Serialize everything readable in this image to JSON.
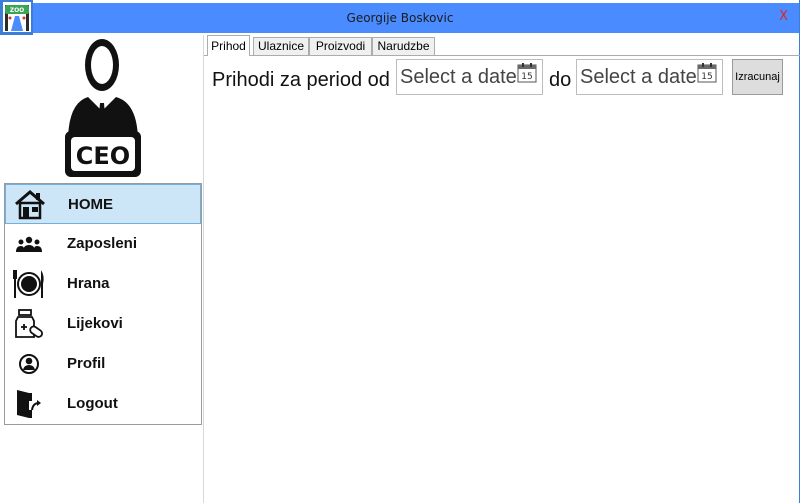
{
  "window": {
    "title": "Georgije Boskovic",
    "close_label": "X",
    "app_icon": "zoo-gate-icon",
    "accent_color": "#4a8cff"
  },
  "sidebar": {
    "logo_text": "CEO",
    "items": [
      {
        "label": "HOME",
        "icon": "home-icon",
        "active": true
      },
      {
        "label": "Zaposleni",
        "icon": "people-icon",
        "active": false
      },
      {
        "label": "Hrana",
        "icon": "plate-cutlery-icon",
        "active": false
      },
      {
        "label": "Lijekovi",
        "icon": "medicine-icon",
        "active": false
      },
      {
        "label": "Profil",
        "icon": "user-icon",
        "active": false
      },
      {
        "label": "Logout",
        "icon": "logout-icon",
        "active": false
      }
    ]
  },
  "main": {
    "tabs": [
      {
        "label": "Prihod",
        "active": true
      },
      {
        "label": "Ulaznice",
        "active": false
      },
      {
        "label": "Proizvodi",
        "active": false
      },
      {
        "label": "Narudzbe",
        "active": false
      }
    ],
    "period_label": "Prihodi za period od",
    "do_label": "do",
    "date_from": {
      "placeholder": "Select a date",
      "calendar_day": "15"
    },
    "date_to": {
      "placeholder": "Select a date",
      "calendar_day": "15"
    },
    "calculate_label": "Izracunaj"
  }
}
